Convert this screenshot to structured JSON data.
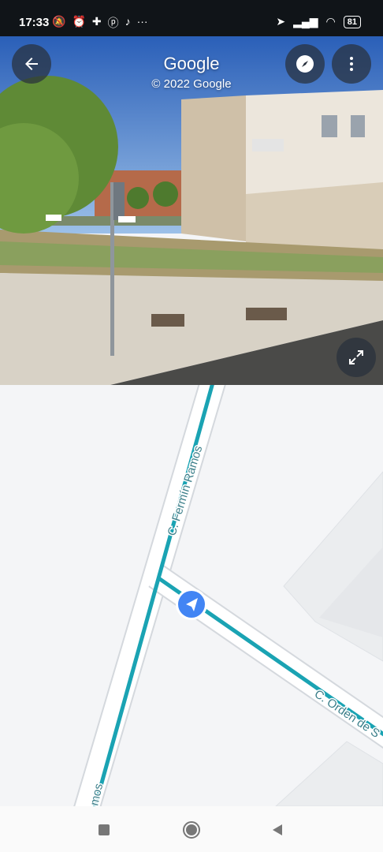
{
  "status_bar": {
    "time": "17:33",
    "battery": "81",
    "left_icons": [
      "notifications-off-icon",
      "alarm-icon",
      "plus-app-icon",
      "pinterest-icon",
      "tiktok-icon",
      "more-dots-icon"
    ],
    "right_icons": [
      "location-arrow-icon",
      "signal-icon",
      "wifi-icon",
      "battery-icon"
    ]
  },
  "street_view": {
    "title": "Google",
    "copyright": "© 2022 Google",
    "buttons": [
      "back-button",
      "compass-button",
      "more-options-button",
      "expand-button"
    ]
  },
  "map": {
    "streets": [
      {
        "label": "C. Fermín Ramos"
      },
      {
        "label": "C. Orden de S"
      },
      {
        "label": "mos"
      }
    ],
    "colors": {
      "route": "#1aa3b3",
      "road": "#ffffff",
      "road_border": "#d4d8dd",
      "background": "#f4f5f7",
      "location_marker": "#4285f4"
    }
  },
  "nav_bar": {
    "buttons": [
      "recents-square-icon",
      "home-circle-icon",
      "back-triangle-icon"
    ]
  }
}
